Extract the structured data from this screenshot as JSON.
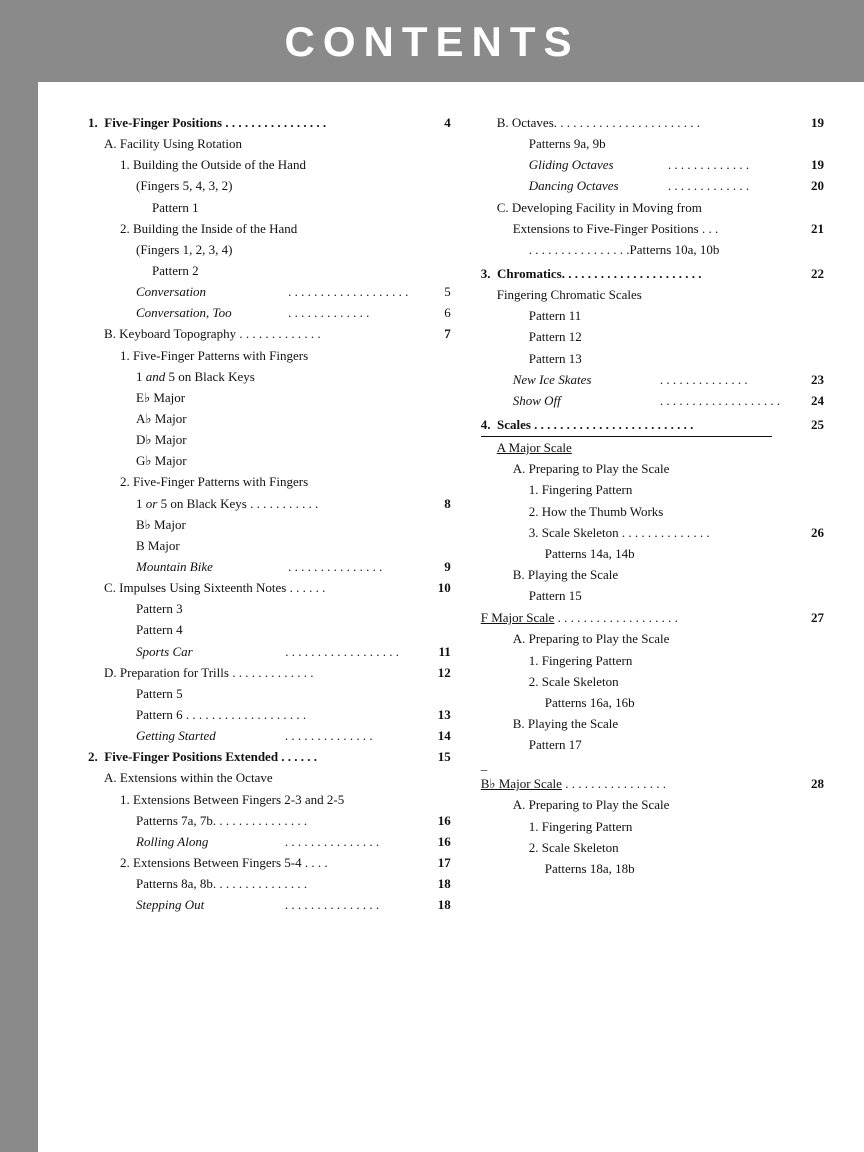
{
  "header": {
    "title": "CONTENTS",
    "bg_color": "#8a8a8a"
  },
  "left_column": {
    "sections": []
  }
}
